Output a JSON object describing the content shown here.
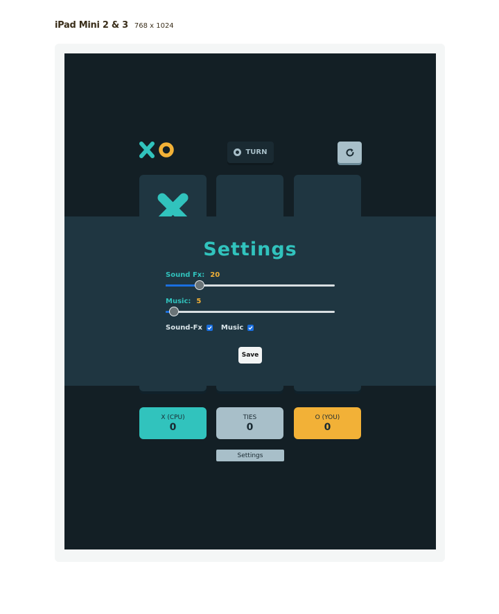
{
  "device": {
    "name": "iPad Mini 2 & 3",
    "size": "768 x 1024"
  },
  "game": {
    "turn_label": "TURN",
    "board": [
      "X",
      "",
      "",
      "",
      "",
      "",
      "",
      "",
      ""
    ],
    "scores": {
      "x": {
        "label": "X (CPU)",
        "value": "0"
      },
      "ties": {
        "label": "TIES",
        "value": "0"
      },
      "o": {
        "label": "O (YOU)",
        "value": "0"
      }
    },
    "settings_button": "Settings"
  },
  "settings_modal": {
    "title": "Settings",
    "sound_fx": {
      "label": "Sound Fx:",
      "value": "20",
      "fraction": 0.2
    },
    "music": {
      "label": "Music:",
      "value": "5",
      "fraction": 0.05
    },
    "checkboxes": [
      {
        "label": "Sound-Fx",
        "checked": true
      },
      {
        "label": "Music",
        "checked": true
      }
    ],
    "save_label": "Save"
  },
  "colors": {
    "x_teal": "#31c3bd",
    "o_yellow": "#f2b137",
    "silver": "#a8bfc9",
    "navy_dark": "#131f25",
    "navy": "#1f3641"
  },
  "icons": {
    "restart": "restart-icon",
    "logo_x": "x-icon",
    "logo_o": "o-icon"
  }
}
